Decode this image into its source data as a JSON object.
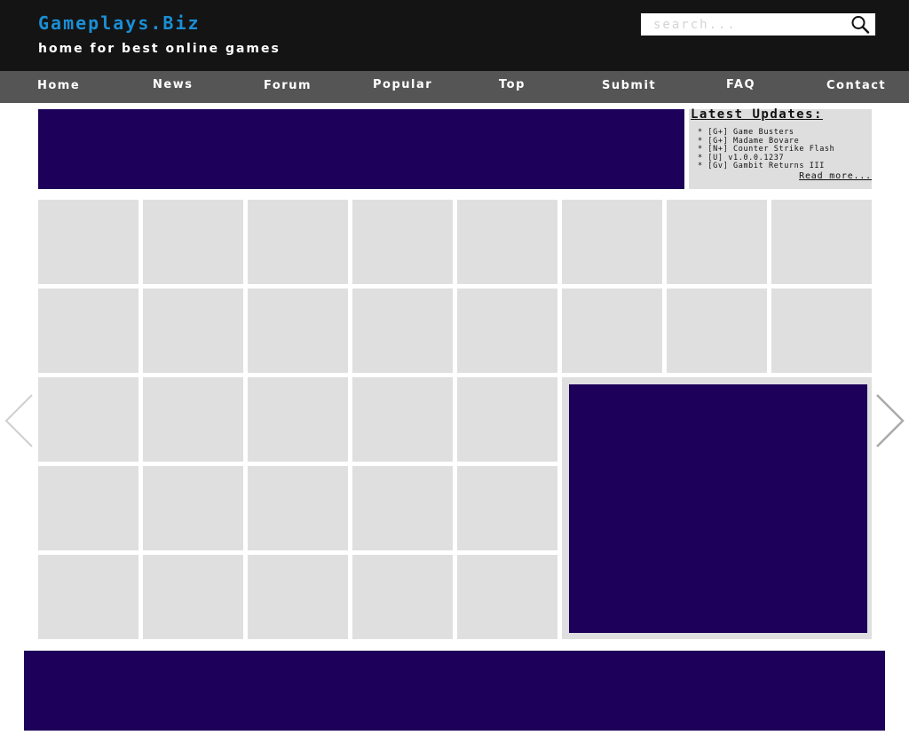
{
  "header": {
    "site_title": "Gameplays.Biz",
    "tagline": "home for best online games",
    "search_placeholder": "search..."
  },
  "nav": {
    "items": [
      {
        "label": "Home"
      },
      {
        "label": "News"
      },
      {
        "label": "Forum"
      },
      {
        "label": "Popular"
      },
      {
        "label": "Top"
      },
      {
        "label": "Submit"
      },
      {
        "label": "FAQ"
      },
      {
        "label": "Contact"
      }
    ]
  },
  "updates": {
    "title": "Latest Updates:",
    "items": [
      "* [G+] Game Busters",
      "* [G+] Madame Bovare",
      "* [N+] Counter Strike Flash",
      "* [U] v1.0.0.1237",
      "* [Gv] Gambit Returns III"
    ],
    "read_more": "Read more..."
  },
  "colors": {
    "header_bg": "#141414",
    "nav_bg": "#555555",
    "brand": "#1a8fd6",
    "ad_bg": "#1c0059",
    "tile_bg": "#dfdfdf"
  },
  "icons": {
    "search": "search-icon",
    "prev": "chevron-left-icon",
    "next": "chevron-right-icon"
  }
}
